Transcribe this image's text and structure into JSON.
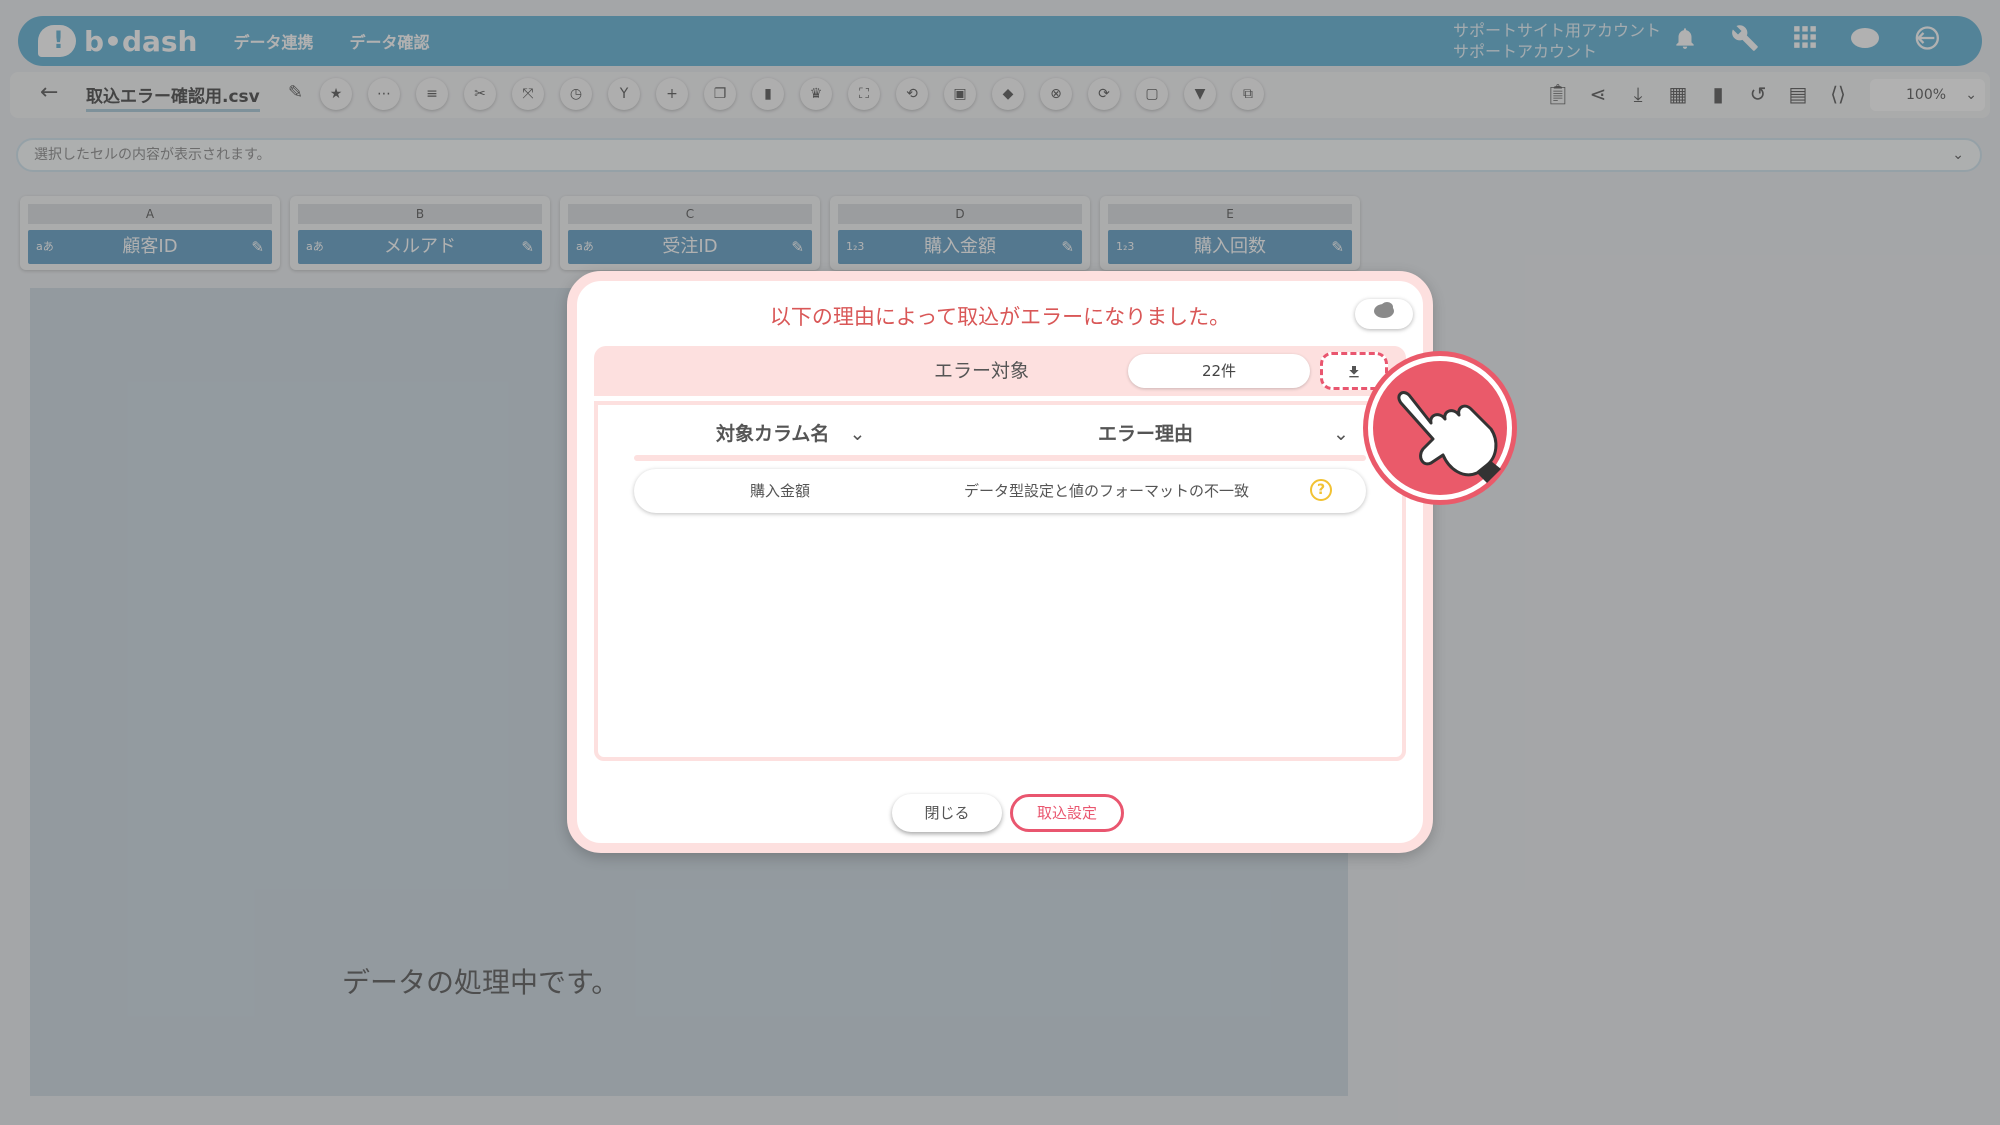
{
  "app": {
    "logo_text": "b•dash",
    "nav": [
      "データ連携",
      "データ確認"
    ],
    "account_line1": "サポートサイト用アカウント",
    "account_line2": "サポートアカウント",
    "top_icons": [
      "bell-icon",
      "wrench-icon",
      "grid-icon",
      "cloud-icon",
      "logout-icon"
    ]
  },
  "toolbar": {
    "file_name": "取込エラー確認用.csv",
    "zoom": "100%"
  },
  "cellbar": {
    "placeholder": "選択したセルの内容が表示されます。"
  },
  "columns": [
    {
      "letter": "A",
      "name": "顧客ID",
      "type": "aあ"
    },
    {
      "letter": "B",
      "name": "メルアド",
      "type": "aあ"
    },
    {
      "letter": "C",
      "name": "受注ID",
      "type": "aあ"
    },
    {
      "letter": "D",
      "name": "購入金額",
      "type": "1₂3"
    },
    {
      "letter": "E",
      "name": "購入回数",
      "type": "1₂3"
    }
  ],
  "table": {
    "processing_text": "データの処理中です。"
  },
  "modal": {
    "title": "以下の理由によって取込がエラーになりました。",
    "error_target_label": "エラー対象",
    "count": "22件",
    "col_target": "対象カラム名",
    "col_reason": "エラー理由",
    "rows": [
      {
        "column": "購入金額",
        "reason": "データ型設定と値のフォーマットの不一致"
      }
    ],
    "close_label": "閉じる",
    "import_settings_label": "取込設定"
  },
  "colors": {
    "brand_blue": "#5eb0d4",
    "accent_pink": "#e9566f",
    "modal_title": "#d95757",
    "modal_border": "#fde0df"
  }
}
